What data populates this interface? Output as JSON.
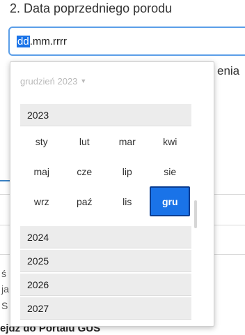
{
  "question": {
    "label": "2. Data poprzedniego porodu"
  },
  "date_input": {
    "segment_day": "dd",
    "rest": ".mm.rrrr"
  },
  "background": {
    "right_fragment": "enia",
    "side_letters": [
      "ś",
      "ja",
      "S"
    ],
    "footer_text": "ejdź do Portalu GUS"
  },
  "picker": {
    "header": "grudzień 2023",
    "header_caret_icon": "caret-down-icon",
    "current_year": "2023",
    "months": [
      "sty",
      "lut",
      "mar",
      "kwi",
      "maj",
      "cze",
      "lip",
      "sie",
      "wrz",
      "paź",
      "lis",
      "gru"
    ],
    "selected_month": "gru",
    "next_years": [
      "2024",
      "2025",
      "2026",
      "2027"
    ],
    "accent_color": "#1a73e8"
  }
}
